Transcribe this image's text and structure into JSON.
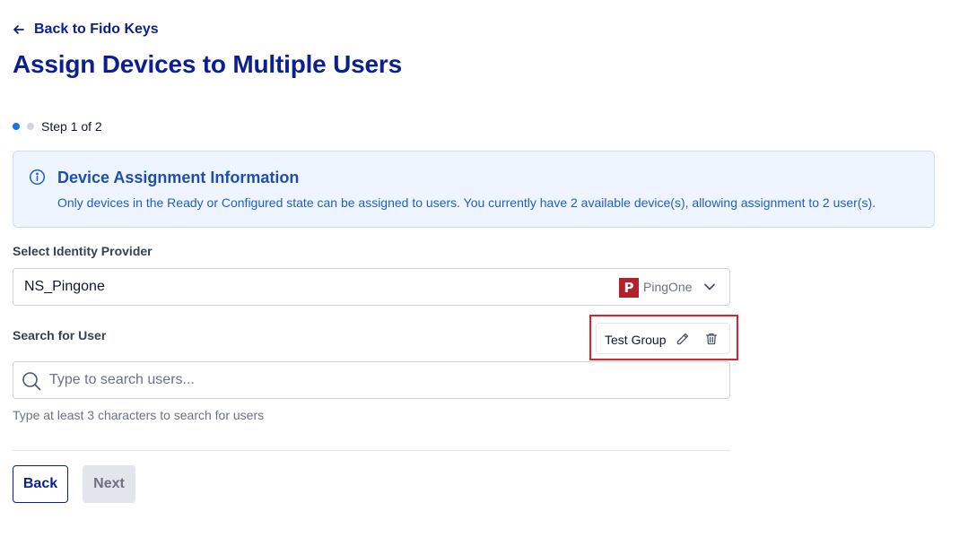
{
  "nav": {
    "back_label": "Back to Fido Keys"
  },
  "page": {
    "title": "Assign Devices to Multiple Users"
  },
  "steps": {
    "label": "Step 1 of 2",
    "current": 1,
    "total": 2
  },
  "info": {
    "title": "Device Assignment Information",
    "text": "Only devices in the Ready or Configured state can be assigned to users. You currently have 2 available device(s), allowing assignment to 2 user(s)."
  },
  "identity_provider": {
    "label": "Select Identity Provider",
    "value": "NS_Pingone",
    "provider_logo_letter": "P",
    "provider_name": "PingOne"
  },
  "search": {
    "label": "Search for User",
    "placeholder": "Type to search users...",
    "value": "",
    "hint": "Type at least 3 characters to search for users"
  },
  "group": {
    "name": "Test Group"
  },
  "buttons": {
    "back": "Back",
    "next": "Next"
  },
  "colors": {
    "primary": "#0b1f8f",
    "accent": "#1a73e8",
    "info_bg": "#eef5ff",
    "highlight": "#e0202a",
    "pingone_red": "#b3202b"
  }
}
